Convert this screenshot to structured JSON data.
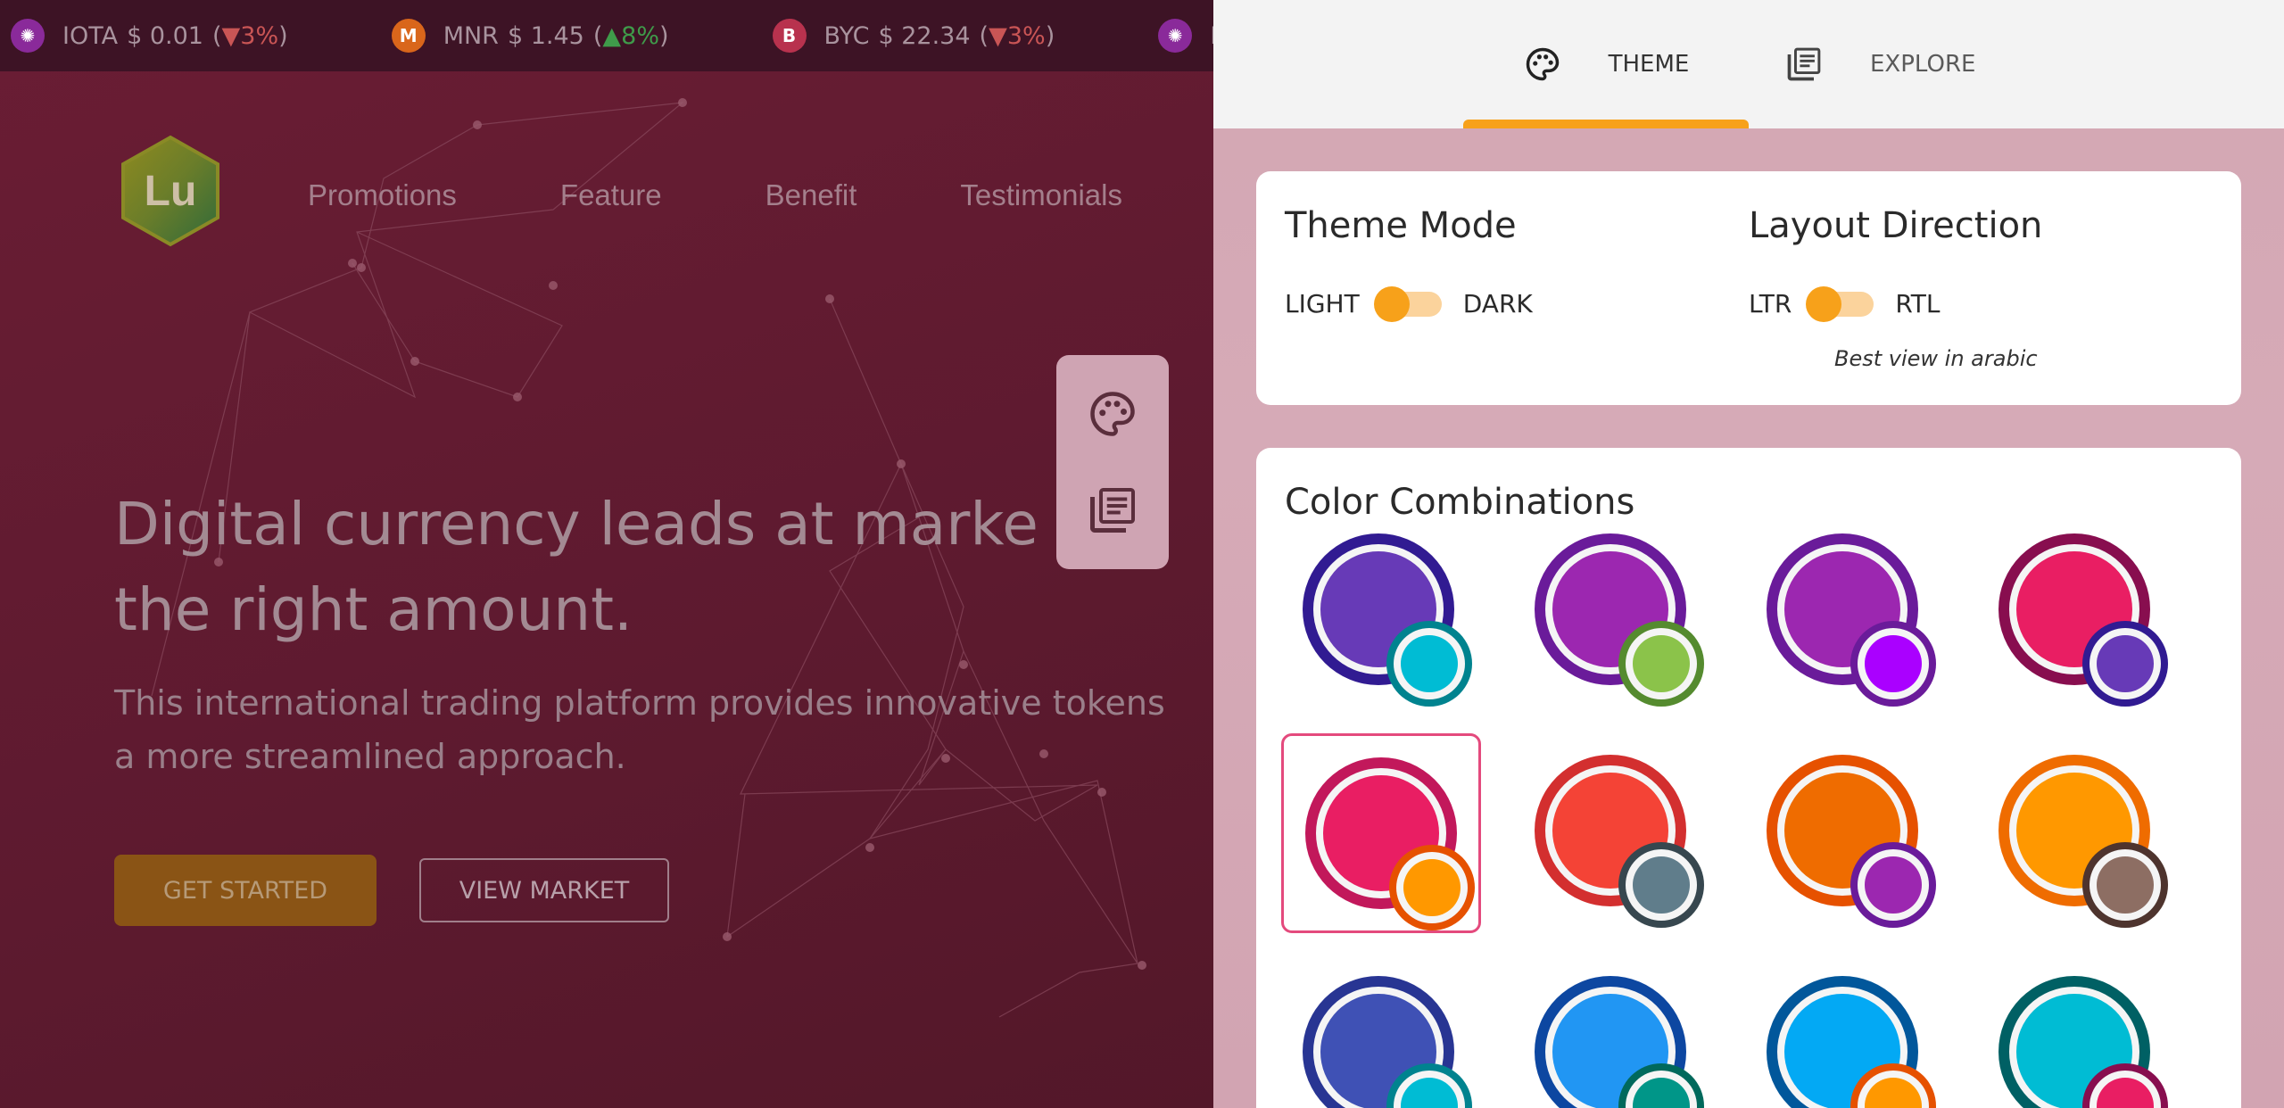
{
  "ticker": [
    {
      "icon": "iota-coin-icon",
      "name": "IOTA",
      "price": "$ 0.01",
      "change": "3%",
      "dir": "down",
      "dir_glyph": "▼"
    },
    {
      "icon": "monero-coin-icon",
      "name": "MNR",
      "price": "$ 1.45",
      "change": "8%",
      "dir": "up",
      "dir_glyph": "▲"
    },
    {
      "icon": "bytecoin-coin-icon",
      "name": "BYC",
      "price": "$ 22.34",
      "change": "3%",
      "dir": "down",
      "dir_glyph": "▼"
    },
    {
      "icon": "iota-coin-icon",
      "name": "IO",
      "price": "",
      "change": "",
      "dir": "",
      "dir_glyph": ""
    }
  ],
  "brand": {
    "logo_text": "Lu"
  },
  "nav": {
    "promotions": "Promotions",
    "feature": "Feature",
    "benefit": "Benefit",
    "testimonials": "Testimonials"
  },
  "hero": {
    "title": "Digital currency leads at marke\nthe right amount.",
    "subtitle": "This international trading platform provides innovative tokens\na more streamlined approach.",
    "primary_button": "GET STARTED",
    "secondary_button": "VIEW MARKET"
  },
  "drawer": {
    "tabs": {
      "theme": "THEME",
      "explore": "EXPLORE"
    },
    "active_tab": "theme",
    "theme_mode": {
      "title": "Theme Mode",
      "off_label": "LIGHT",
      "on_label": "DARK",
      "value": "LIGHT"
    },
    "layout_direction": {
      "title": "Layout Direction",
      "off_label": "LTR",
      "on_label": "RTL",
      "value": "LTR",
      "hint": "Best view in arabic"
    },
    "color_combinations": {
      "title": "Color Combinations",
      "selected_index": 4,
      "swatches": [
        {
          "main": "#673ab7",
          "border": "#311b92",
          "secondary": "#00bcd4",
          "secondary_border": "#00838f"
        },
        {
          "main": "#9c27b0",
          "border": "#6a1b9a",
          "secondary": "#8bc34a",
          "secondary_border": "#558b2f"
        },
        {
          "main": "#9c27b0",
          "border": "#6a1b9a",
          "secondary": "#aa00ff",
          "secondary_border": "#6a1b9a"
        },
        {
          "main": "#e91e63",
          "border": "#880e4f",
          "secondary": "#673ab7",
          "secondary_border": "#311b92"
        },
        {
          "main": "#e91e63",
          "border": "#c2185b",
          "secondary": "#ff9800",
          "secondary_border": "#e65100"
        },
        {
          "main": "#f44336",
          "border": "#d32f2f",
          "secondary": "#607d8b",
          "secondary_border": "#37474f"
        },
        {
          "main": "#ef6c00",
          "border": "#e65100",
          "secondary": "#9c27b0",
          "secondary_border": "#6a1b9a"
        },
        {
          "main": "#ff9800",
          "border": "#ef6c00",
          "secondary": "#8d6e63",
          "secondary_border": "#4e342e"
        },
        {
          "main": "#3f51b5",
          "border": "#283593",
          "secondary": "#00bcd4",
          "secondary_border": "#00838f"
        },
        {
          "main": "#2196f3",
          "border": "#0d47a1",
          "secondary": "#009688",
          "secondary_border": "#00695c"
        },
        {
          "main": "#03a9f4",
          "border": "#01579b",
          "secondary": "#ff9800",
          "secondary_border": "#e65100"
        },
        {
          "main": "#00bcd4",
          "border": "#006064",
          "secondary": "#e91e63",
          "secondary_border": "#880e4f"
        }
      ]
    }
  },
  "colors": {
    "accent": "#f7a11a",
    "selection": "#e44a7d"
  }
}
